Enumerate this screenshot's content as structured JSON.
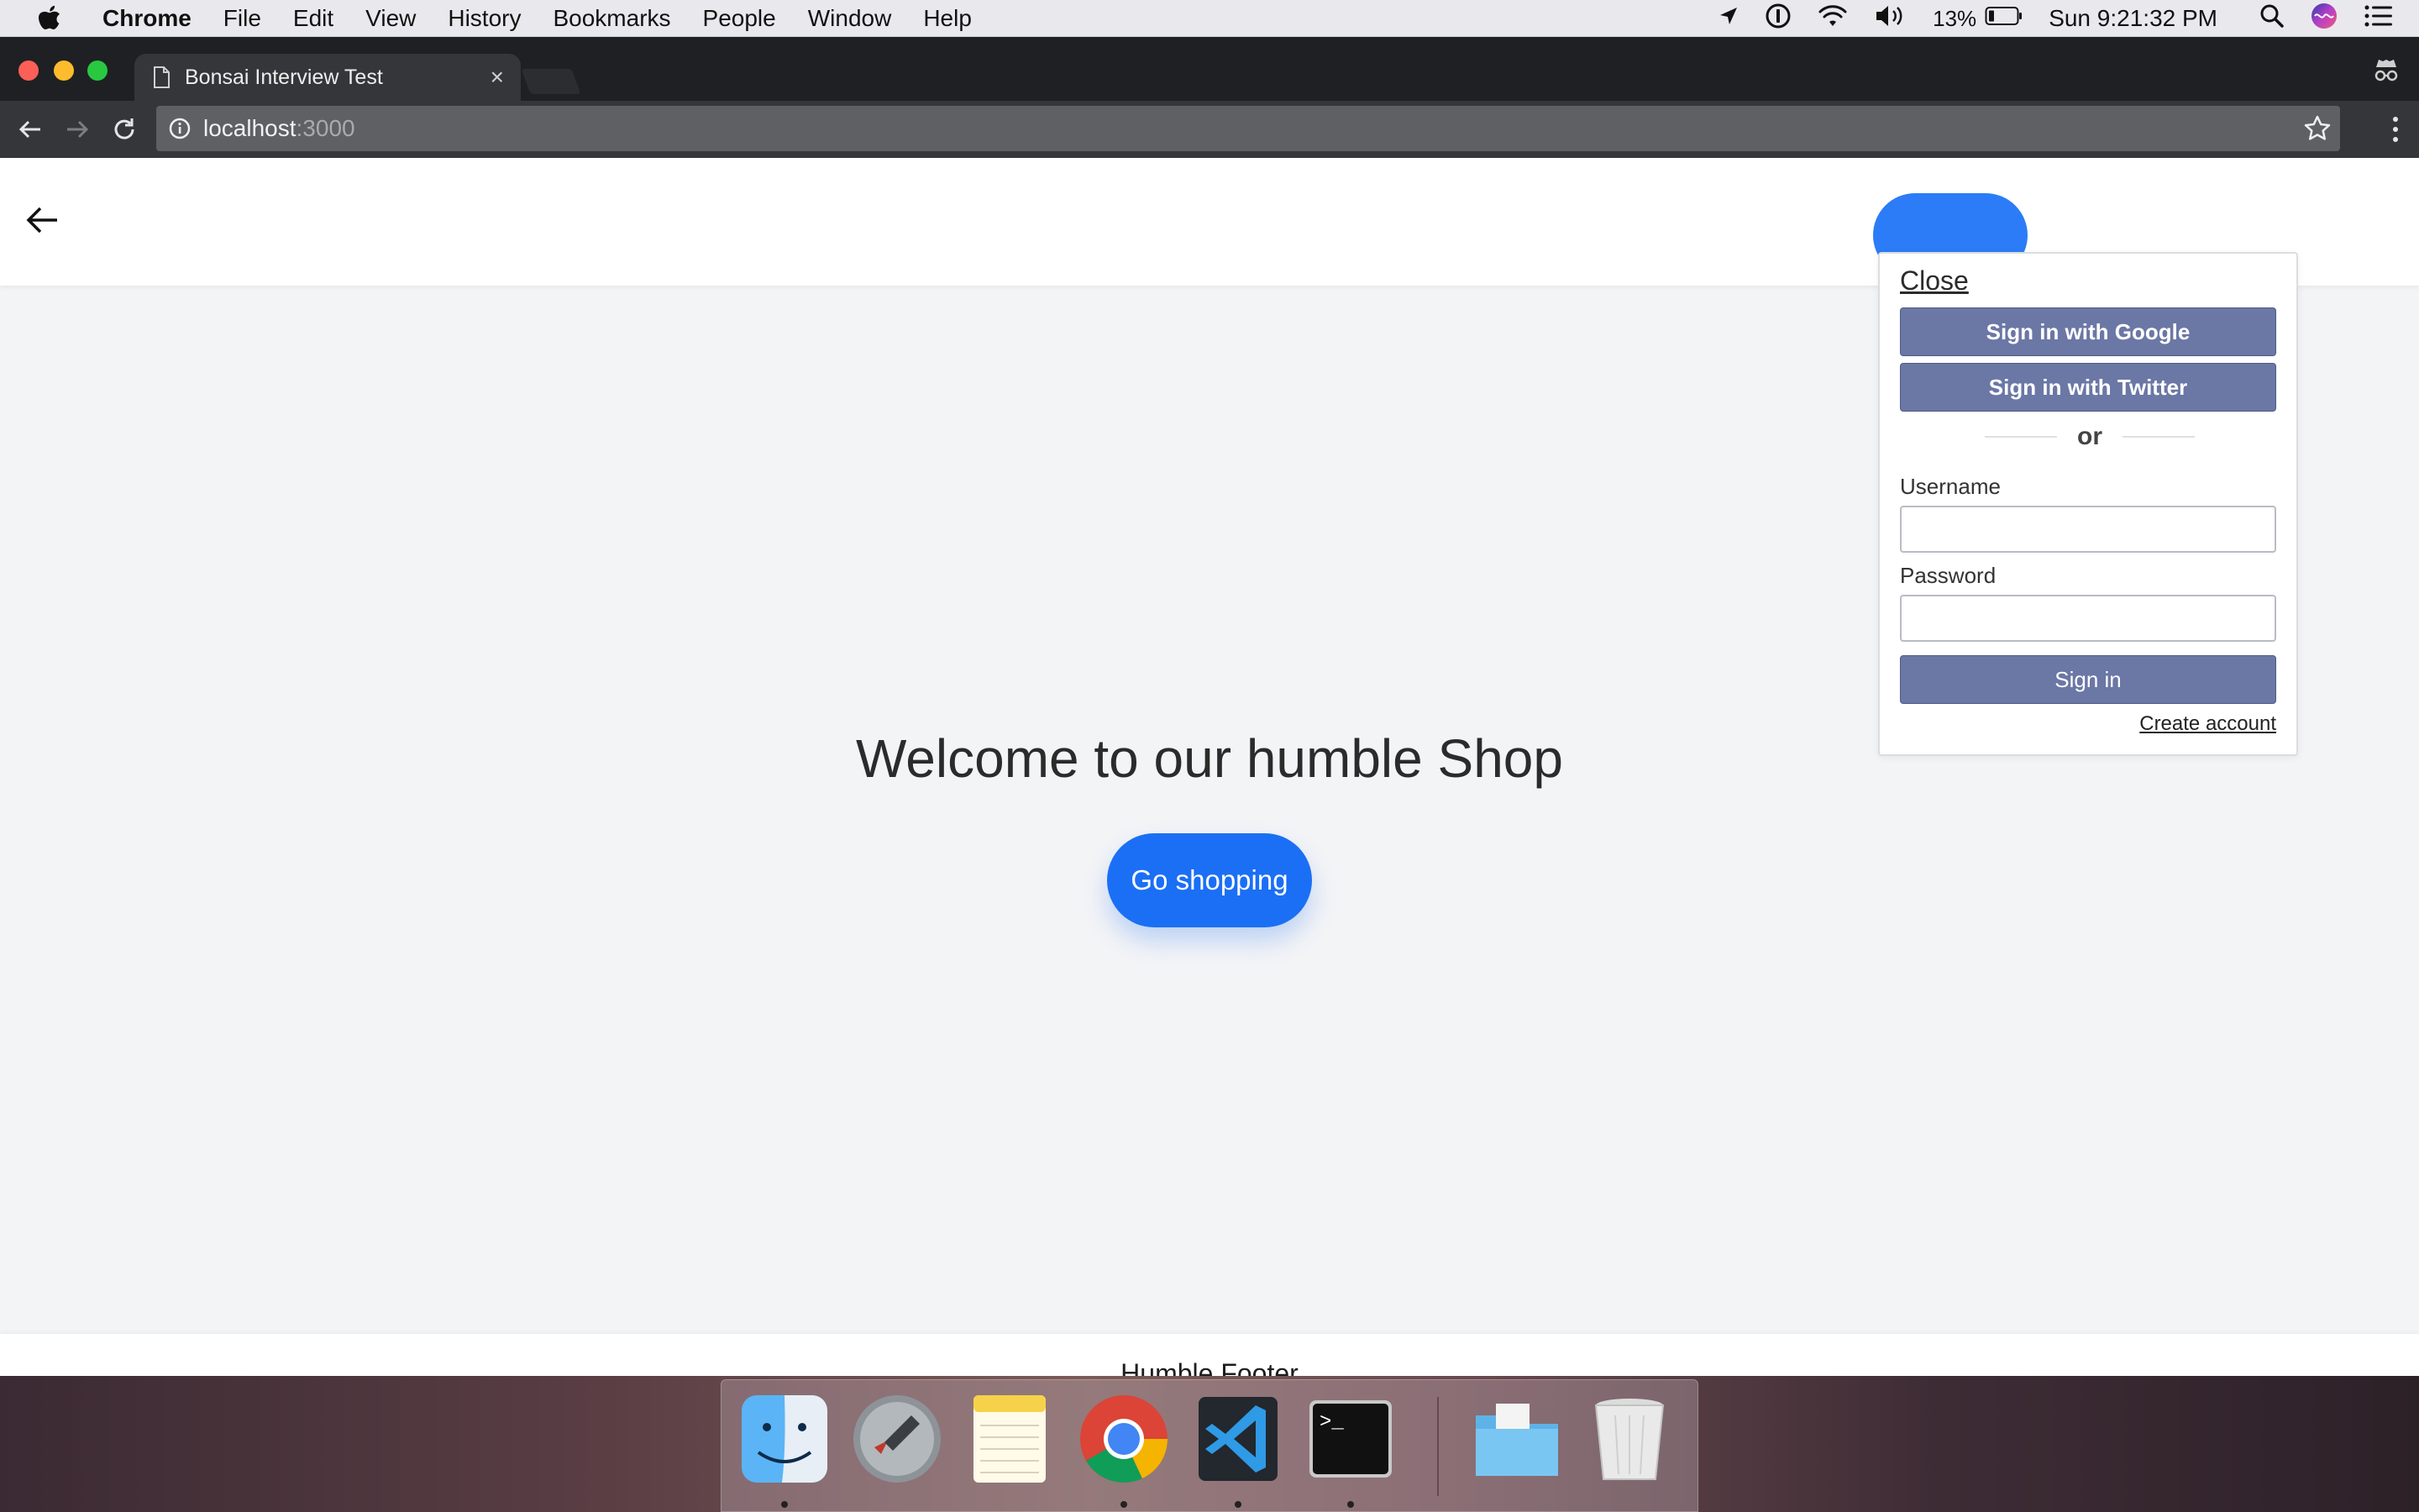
{
  "menubar": {
    "app_name": "Chrome",
    "menus": [
      "File",
      "Edit",
      "View",
      "History",
      "Bookmarks",
      "People",
      "Window",
      "Help"
    ],
    "battery_percent": "13%",
    "clock": "Sun 9:21:32 PM",
    "icons": [
      "apple-icon",
      "location-icon",
      "onepassword-icon",
      "wifi-icon",
      "volume-icon",
      "battery-icon",
      "spotlight-icon",
      "siri-icon",
      "notification-center-icon"
    ]
  },
  "browser": {
    "tab_title": "Bonsai Interview Test",
    "tab_close": "×",
    "url_host": "localhost",
    "url_port": ":3000"
  },
  "page": {
    "welcome": "Welcome to our humble Shop",
    "cta": "Go shopping",
    "footer": "Humble Footer"
  },
  "signin": {
    "close": "Close",
    "google": "Sign in with Google",
    "twitter": "Sign in with Twitter",
    "or": "or",
    "username_label": "Username",
    "username_value": "",
    "password_label": "Password",
    "password_value": "",
    "submit": "Sign in",
    "create_account": "Create account"
  },
  "dock": {
    "apps": [
      "finder-icon",
      "launchpad-icon",
      "notes-icon",
      "chrome-icon",
      "vscode-icon",
      "terminal-icon",
      "folder-icon",
      "trash-icon"
    ],
    "terminal_prompt": ">_"
  },
  "colors": {
    "primary": "#1b6ff5",
    "auth_button": "#6b77a5",
    "page_bg": "#f3f4f6"
  }
}
